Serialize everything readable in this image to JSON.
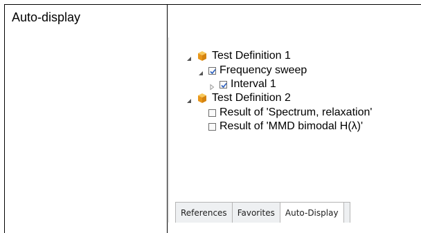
{
  "table": {
    "row_label": "Auto-display"
  },
  "tree": {
    "items": [
      {
        "label": "Test Definition 1"
      },
      {
        "label": "Frequency sweep"
      },
      {
        "label": "Interval 1"
      },
      {
        "label": "Test Definition 2"
      },
      {
        "label": "Result of 'Spectrum, relaxation'"
      },
      {
        "label": "Result of 'MMD bimodal H(λ)'"
      }
    ]
  },
  "tabs": [
    {
      "label": "References"
    },
    {
      "label": "Favorites"
    },
    {
      "label": "Auto-Display"
    }
  ],
  "colors": {
    "cube": "#f0a21a",
    "check": "#2b5fbf",
    "expander": "#555555"
  }
}
